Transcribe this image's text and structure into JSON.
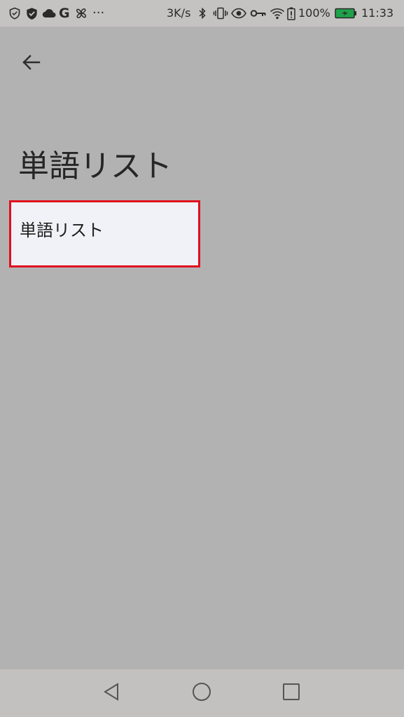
{
  "status_bar": {
    "network_speed": "3K/s",
    "battery_percent": "100%",
    "time": "11:33",
    "left_icons": [
      "shield-outline-icon",
      "shield-check-icon",
      "cloud-icon",
      "google-icon",
      "fan-icon",
      "more-icon"
    ],
    "more_text": "···",
    "google_letter": "G",
    "right_icons": [
      "bluetooth-icon",
      "vibrate-icon",
      "eye-icon",
      "key-icon",
      "wifi-icon",
      "battery-alert-icon",
      "battery-charging-icon"
    ]
  },
  "header": {
    "back_icon": "arrow-left-icon"
  },
  "page": {
    "title": "単語リスト",
    "items": [
      {
        "label": "単語リスト"
      }
    ]
  },
  "nav_bar": {
    "icons": [
      "back-triangle-icon",
      "home-circle-icon",
      "recents-square-icon"
    ]
  },
  "colors": {
    "status_bar_bg": "#c5c3c2",
    "screen_bg": "#b3b2b3",
    "item_bg": "#f0f2f7",
    "highlight_border": "#e0101e",
    "battery_green": "#1fa24a"
  }
}
